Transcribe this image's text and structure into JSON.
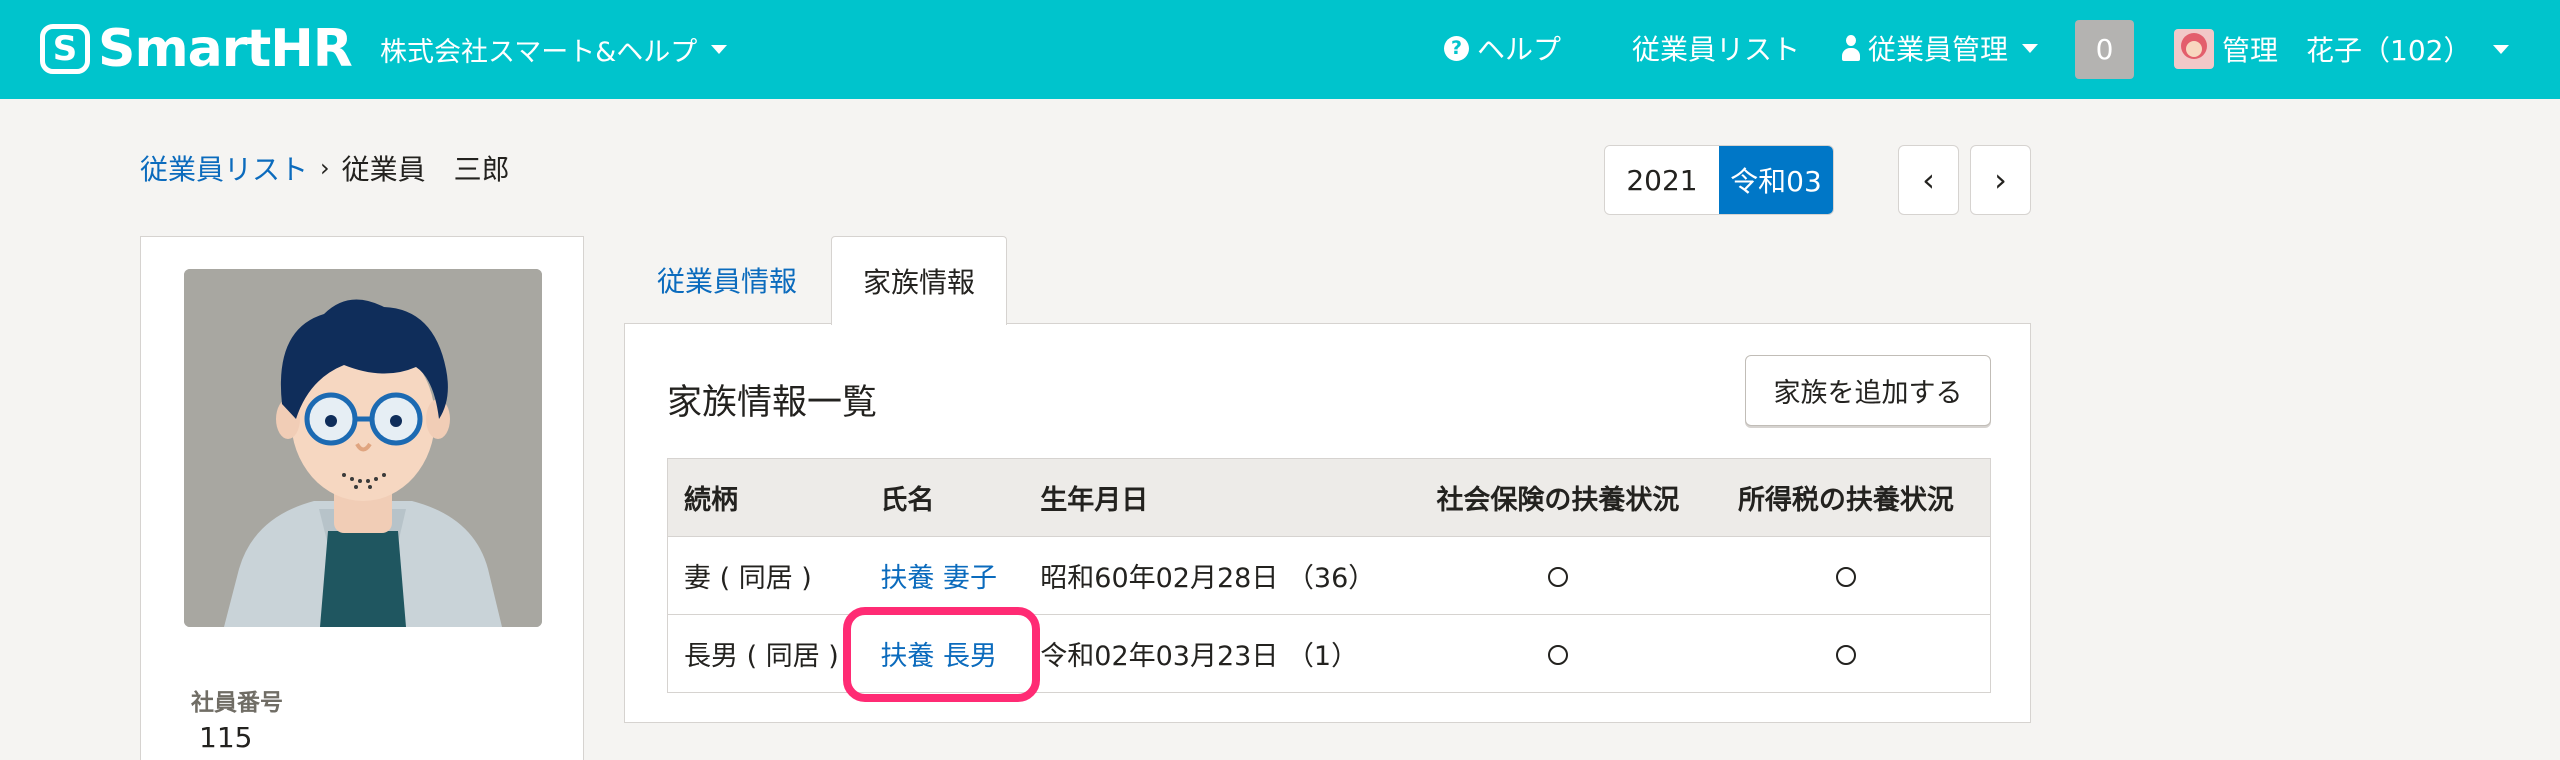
{
  "header": {
    "logo_mark": "S",
    "logo_text": "SmartHR",
    "company": "株式会社スマート&ヘルプ",
    "help": "ヘルプ",
    "help_icon_glyph": "?",
    "employee_list": "従業員リスト",
    "employee_manage": "従業員管理",
    "notification_count": "0",
    "user": "管理　花子（102）"
  },
  "breadcrumb": {
    "parent": "従業員リスト",
    "separator": "›",
    "current": "従業員　三郎"
  },
  "year_switch": {
    "western": "2021",
    "japanese": "令和03",
    "prev": "‹",
    "next": "›"
  },
  "profile": {
    "employee_number_label": "社員番号",
    "employee_number": "115"
  },
  "tabs": {
    "employee_info": "従業員情報",
    "family_info": "家族情報"
  },
  "family": {
    "title": "家族情報一覧",
    "add_button": "家族を追加する",
    "columns": [
      "続柄",
      "氏名",
      "生年月日",
      "社会保険の扶養状況",
      "所得税の扶養状況"
    ],
    "rows": [
      {
        "relation": "妻 ( 同居 )",
        "name": "扶養 妻子",
        "birth": "昭和60年02月28日 （36）",
        "social_insurance": "○",
        "income_tax": "○"
      },
      {
        "relation": "長男 ( 同居 )",
        "name": "扶養 長男",
        "birth": "令和02年03月23日 （1）",
        "social_insurance": "○",
        "income_tax": "○"
      }
    ]
  },
  "colors": {
    "header_bg": "#00c4cc",
    "link": "#0b6bbd",
    "active_year": "#0077c7",
    "highlight": "#ff2b74"
  }
}
